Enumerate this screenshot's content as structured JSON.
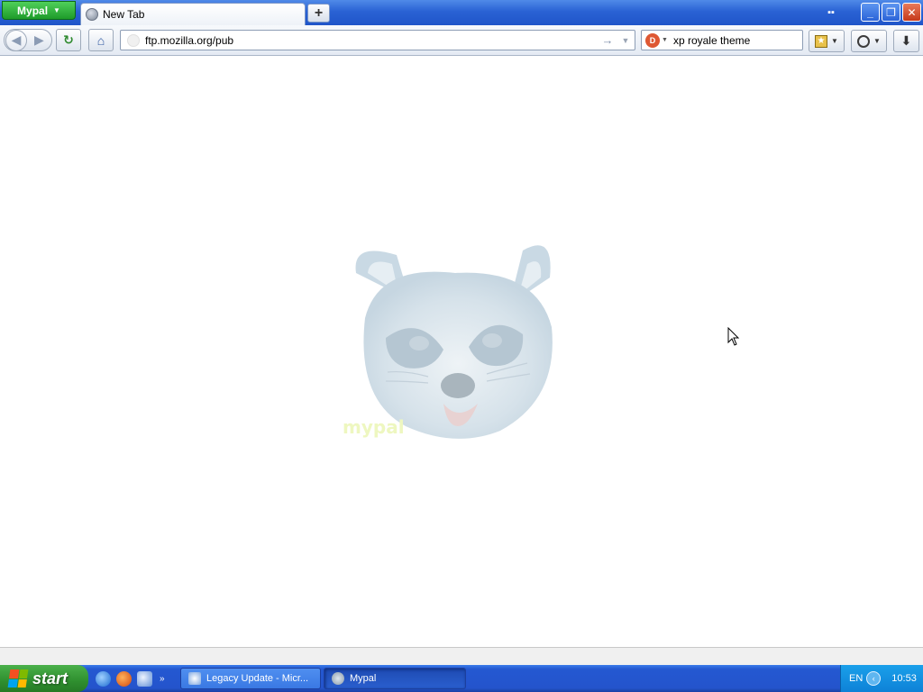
{
  "browser": {
    "menu_label": "Mypal",
    "tab": {
      "title": "New Tab"
    },
    "newtab_symbol": "+",
    "window_controls": {
      "minimize": "_",
      "maximize": "❐",
      "close": "✕"
    }
  },
  "navbar": {
    "url": "ftp.mozilla.org/pub",
    "search_value": "xp royale theme",
    "search_engine_icon": "duckduckgo-icon"
  },
  "content": {
    "mascot_text": "mypal"
  },
  "taskbar": {
    "start_label": "start",
    "tasks": [
      {
        "label": "Legacy Update - Micr..."
      },
      {
        "label": "Mypal"
      }
    ],
    "tray": {
      "language": "EN",
      "time": "10:53"
    }
  },
  "colors": {
    "titlebar": "#2a62d4",
    "taskbar": "#2454cc",
    "start": "#2f8f2f",
    "tray": "#0e82d7"
  }
}
